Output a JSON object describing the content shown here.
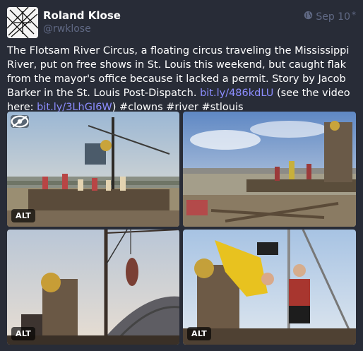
{
  "post": {
    "display_name": "Roland Klose",
    "account": "@rwklose",
    "date": "Sep 10",
    "edited_mark": "*",
    "visibility_icon": "globe-icon",
    "text_before_link1": "The Flotsam River Circus, a floating circus traveling the Mississippi River, put on free shows in St. Louis this weekend, but caught flak from the mayor's office because it lacked a permit. Story by Jacob Barker in the St. Louis Post-Dispatch.",
    "link1": "bit.ly/486kdLU",
    "text_between": "(see the video here:",
    "link2": "bit.ly/3LhGI6W",
    "text_after": ") #clowns #river #stlouis"
  },
  "media": {
    "alt_label": "ALT",
    "hide_icon": "eye-slash-icon",
    "images": [
      {
        "name": "raft-circus-performers"
      },
      {
        "name": "shore-raft-acrobats"
      },
      {
        "name": "hanging-acrobat-sousaphone"
      },
      {
        "name": "upside-down-clown-sousaphone"
      }
    ]
  },
  "colors": {
    "background": "#282c37",
    "link": "#8c8dff",
    "muted": "#606984",
    "text": "#ffffff"
  }
}
